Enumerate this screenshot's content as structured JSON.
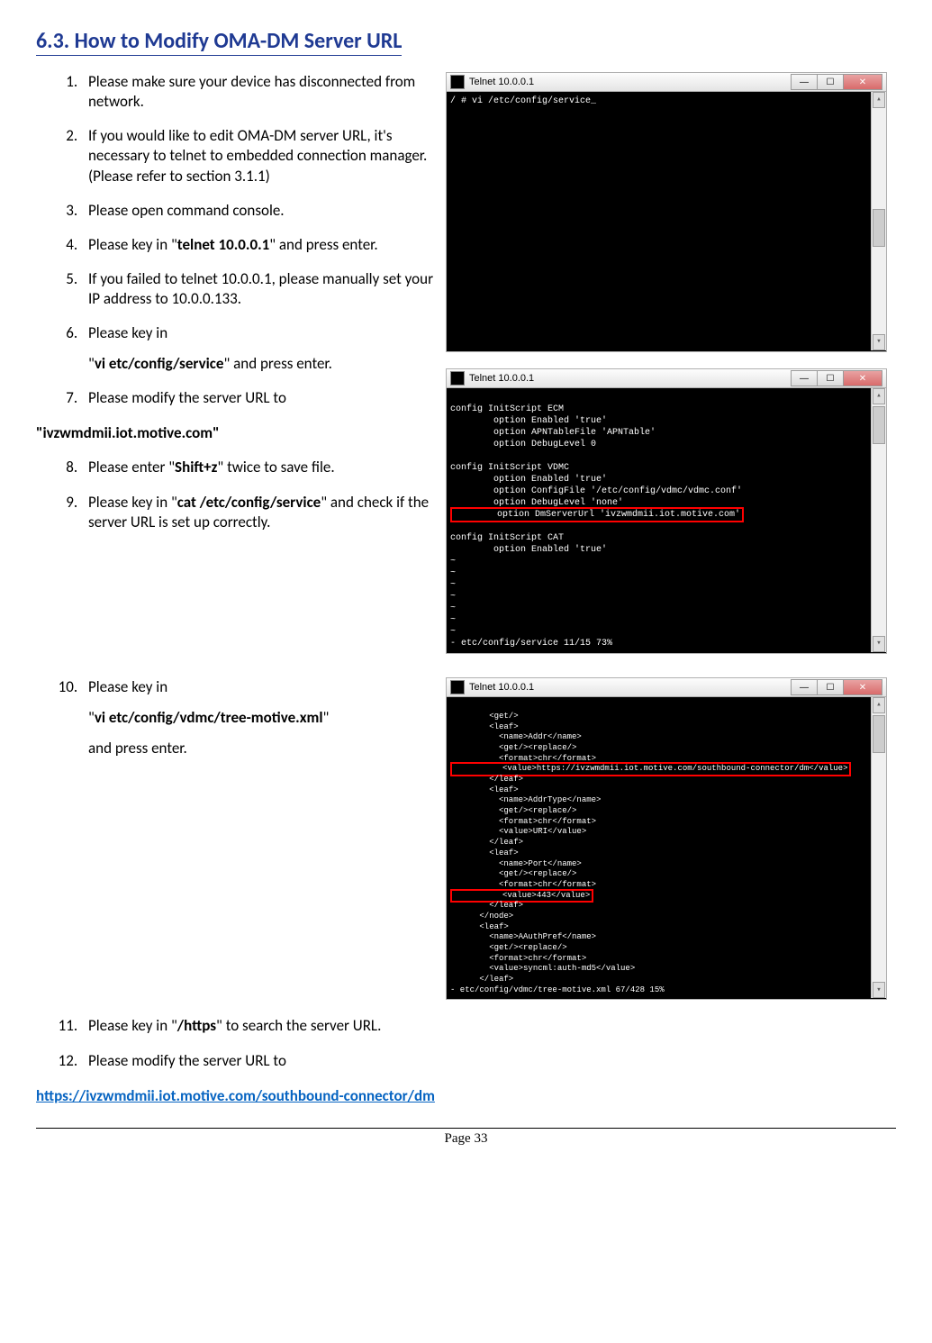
{
  "heading": "6.3. How to Modify OMA-DM Server URL",
  "steps_part1": [
    "Please make sure your device has disconnected from network.",
    "If you would like to edit OMA-DM server URL, it's necessary to telnet to embedded connection manager. (Please refer to section 3.1.1)",
    "Please open command console."
  ],
  "step4_pre": "Please key in \"",
  "step4_bold": "telnet 10.0.0.1",
  "step4_post": "\" and press enter.",
  "step5": "If you failed to telnet 10.0.0.1, please manually set your IP address to 10.0.0.133.",
  "step6": "Please key in",
  "step6_sub_pre": "\"",
  "step6_sub_bold": "vi etc/config/service",
  "step6_sub_post": "\" and press enter.",
  "step7": "Please modify the server URL to",
  "url1": "\"ivzwmdmii.iot.motive.com\"",
  "step8_pre": "Please enter \"",
  "step8_bold": "Shift+z",
  "step8_post": "\" twice to save file.",
  "step9_pre": "Please key in \"",
  "step9_bold": "cat /etc/config/service",
  "step9_post": "\" and check if the server URL is set up correctly.",
  "step10": "Please key in",
  "step10_sub_pre": "\"",
  "step10_sub_bold": "vi etc/config/vdmc/tree-motive.xml",
  "step10_sub_post": "\"",
  "step10_sub2": "and press enter.",
  "step11_pre": "Please key in \"",
  "step11_bold": "/https",
  "step11_post": "\" to search the server URL.",
  "step12": "Please modify the server URL to",
  "url2": "https://ivzwmdmii.iot.motive.com/southbound-connector/dm",
  "page_footer": "Page 33",
  "term_title": "Telnet 10.0.0.1",
  "term1_body": "/ # vi /etc/config/service_",
  "term2_lines": {
    "l1": "config InitScript ECM",
    "l2": "        option Enabled 'true'",
    "l3": "        option APNTableFile 'APNTable'",
    "l4": "        option DebugLevel 0",
    "l5": "",
    "l6": "config InitScript VDMC",
    "l7": "        option Enabled 'true'",
    "l8": "        option ConfigFile '/etc/config/vdmc/vdmc.conf'",
    "l9": "        option DebugLevel 'none'",
    "l10": "        option DmServerUrl 'ivzwmdmii.iot.motive.com'",
    "l11": "",
    "l12": "config InitScript CAT",
    "l13": "        option Enabled 'true'",
    "tilde": "~",
    "status": "- etc/config/service 11/15 73%"
  },
  "term3_lines": {
    "l1": "        <get/>",
    "l2": "        <leaf>",
    "l3": "          <name>Addr</name>",
    "l4": "          <get/><replace/>",
    "l5": "          <format>chr</format>",
    "l6": "          <value>https://ivzwmdmii.iot.motive.com/southbound-connector/dm</value>",
    "l7": "        </leaf>",
    "l8": "        <leaf>",
    "l9": "          <name>AddrType</name>",
    "l10": "          <get/><replace/>",
    "l11": "          <format>chr</format>",
    "l12": "          <value>URI</value>",
    "l13": "        </leaf>",
    "l14": "        <leaf>",
    "l15": "          <name>Port</name>",
    "l16": "          <get/><replace/>",
    "l17": "          <format>chr</format>",
    "l18": "          <value>443</value>",
    "l19": "        </leaf>",
    "l20": "      </node>",
    "l21": "      <leaf>",
    "l22": "        <name>AAuthPref</name>",
    "l23": "        <get/><replace/>",
    "l24": "        <format>chr</format>",
    "l25": "        <value>syncml:auth-md5</value>",
    "l26": "      </leaf>",
    "status": "- etc/config/vdmc/tree-motive.xml 67/428 15%"
  }
}
